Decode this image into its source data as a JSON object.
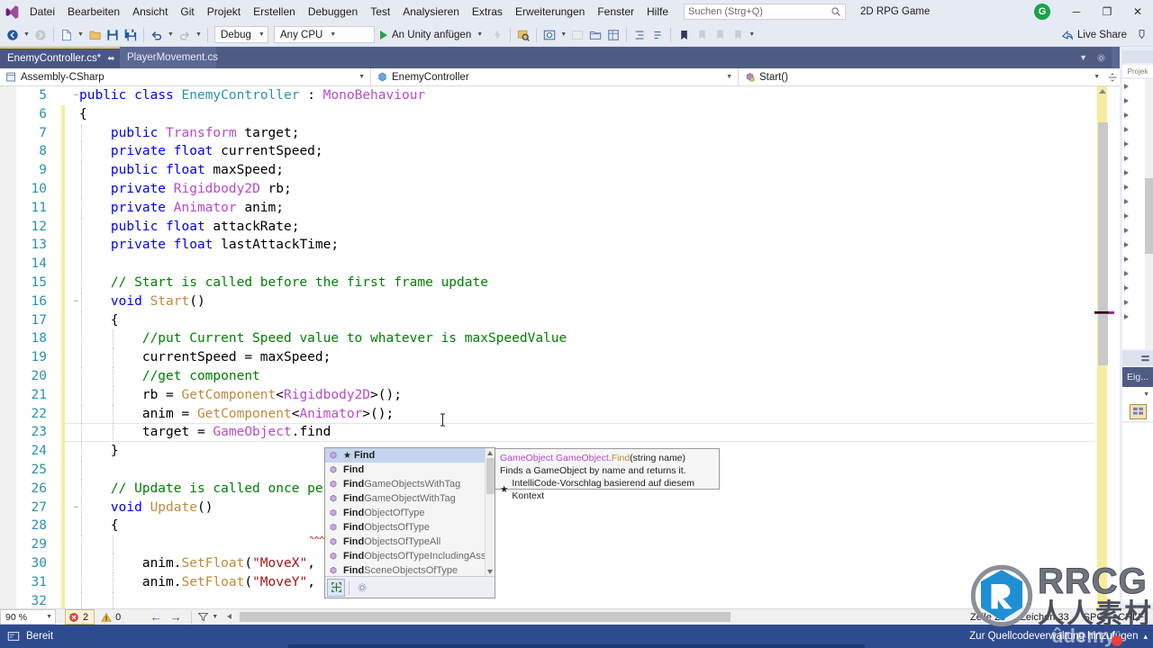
{
  "window": {
    "menus": [
      "Datei",
      "Bearbeiten",
      "Ansicht",
      "Git",
      "Projekt",
      "Erstellen",
      "Debuggen",
      "Test",
      "Analysieren",
      "Extras",
      "Erweiterungen",
      "Fenster",
      "Hilfe"
    ],
    "search_placeholder": "Suchen (Strg+Q)",
    "solution_name": "2D RPG Game",
    "account_initial": "G",
    "minimize_label": "─",
    "restore_label": "❐",
    "close_label": "✕"
  },
  "toolbar": {
    "config_value": "Debug",
    "platform_value": "Any CPU",
    "run_label": "An Unity anfügen",
    "live_share_label": "Live Share"
  },
  "tabs": [
    {
      "label": "EnemyController.cs*",
      "active": true,
      "pin": "⬌",
      "close": "✕"
    },
    {
      "label": "PlayerMovement.cs",
      "active": false
    }
  ],
  "tool_window_tab": "Proj...",
  "navbar": {
    "project": "Assembly-CSharp",
    "type": "EnemyController",
    "member": "Start()",
    "caret": "▾"
  },
  "editor": {
    "first_line_number": 5,
    "lines": [
      {
        "n": 5,
        "fold": "−",
        "indent": 0,
        "tokens": [
          [
            "kw",
            "public"
          ],
          [
            "pln",
            " "
          ],
          [
            "kw",
            "class"
          ],
          [
            "pln",
            " "
          ],
          [
            "typ",
            "EnemyController"
          ],
          [
            "pln",
            " : "
          ],
          [
            "utyp",
            "MonoBehaviour"
          ]
        ]
      },
      {
        "n": 6,
        "fold": "",
        "indent": 0,
        "tokens": [
          [
            "pln",
            "{"
          ]
        ]
      },
      {
        "n": 7,
        "fold": "",
        "indent": 1,
        "tokens": [
          [
            "pln",
            "    "
          ],
          [
            "kw",
            "public"
          ],
          [
            "pln",
            " "
          ],
          [
            "utyp",
            "Transform"
          ],
          [
            "pln",
            " target;"
          ]
        ]
      },
      {
        "n": 8,
        "fold": "",
        "indent": 1,
        "tokens": [
          [
            "pln",
            "    "
          ],
          [
            "kw",
            "private"
          ],
          [
            "pln",
            " "
          ],
          [
            "kw",
            "float"
          ],
          [
            "pln",
            " currentSpeed;"
          ]
        ]
      },
      {
        "n": 9,
        "fold": "",
        "indent": 1,
        "tokens": [
          [
            "pln",
            "    "
          ],
          [
            "kw",
            "public"
          ],
          [
            "pln",
            " "
          ],
          [
            "kw",
            "float"
          ],
          [
            "pln",
            " maxSpeed;"
          ]
        ]
      },
      {
        "n": 10,
        "fold": "",
        "indent": 1,
        "tokens": [
          [
            "pln",
            "    "
          ],
          [
            "kw",
            "private"
          ],
          [
            "pln",
            " "
          ],
          [
            "utyp",
            "Rigidbody2D"
          ],
          [
            "pln",
            " rb;"
          ]
        ]
      },
      {
        "n": 11,
        "fold": "",
        "indent": 1,
        "tokens": [
          [
            "pln",
            "    "
          ],
          [
            "kw",
            "private"
          ],
          [
            "pln",
            " "
          ],
          [
            "utyp",
            "Animator"
          ],
          [
            "pln",
            " anim;"
          ]
        ]
      },
      {
        "n": 12,
        "fold": "",
        "indent": 1,
        "tokens": [
          [
            "pln",
            "    "
          ],
          [
            "kw",
            "public"
          ],
          [
            "pln",
            " "
          ],
          [
            "kw",
            "float"
          ],
          [
            "pln",
            " attackRate;"
          ]
        ]
      },
      {
        "n": 13,
        "fold": "",
        "indent": 1,
        "tokens": [
          [
            "pln",
            "    "
          ],
          [
            "kw",
            "private"
          ],
          [
            "pln",
            " "
          ],
          [
            "kw",
            "float"
          ],
          [
            "pln",
            " lastAttackTime;"
          ]
        ]
      },
      {
        "n": 14,
        "fold": "",
        "indent": 1,
        "tokens": [
          [
            "pln",
            ""
          ]
        ]
      },
      {
        "n": 15,
        "fold": "",
        "indent": 1,
        "tokens": [
          [
            "pln",
            "    "
          ],
          [
            "cmt",
            "// Start is called before the first frame update"
          ]
        ]
      },
      {
        "n": 16,
        "fold": "−",
        "indent": 1,
        "tokens": [
          [
            "pln",
            "    "
          ],
          [
            "kw",
            "void"
          ],
          [
            "pln",
            " "
          ],
          [
            "meth",
            "Start"
          ],
          [
            "pln",
            "()"
          ]
        ]
      },
      {
        "n": 17,
        "fold": "",
        "indent": 1,
        "tokens": [
          [
            "pln",
            "    {"
          ]
        ]
      },
      {
        "n": 18,
        "fold": "",
        "indent": 2,
        "tokens": [
          [
            "pln",
            "        "
          ],
          [
            "cmt",
            "//put Current Speed value to whatever is maxSpeedValue"
          ]
        ]
      },
      {
        "n": 19,
        "fold": "",
        "indent": 2,
        "tokens": [
          [
            "pln",
            "        currentSpeed = maxSpeed;"
          ]
        ]
      },
      {
        "n": 20,
        "fold": "",
        "indent": 2,
        "tokens": [
          [
            "pln",
            "        "
          ],
          [
            "cmt",
            "//get component"
          ]
        ]
      },
      {
        "n": 21,
        "fold": "",
        "indent": 2,
        "tokens": [
          [
            "pln",
            "        rb = "
          ],
          [
            "meth",
            "GetComponent"
          ],
          [
            "pln",
            "<"
          ],
          [
            "utyp",
            "Rigidbody2D"
          ],
          [
            "pln",
            ">();"
          ]
        ]
      },
      {
        "n": 22,
        "fold": "",
        "indent": 2,
        "tokens": [
          [
            "pln",
            "        anim = "
          ],
          [
            "meth",
            "GetComponent"
          ],
          [
            "pln",
            "<"
          ],
          [
            "utyp",
            "Animator"
          ],
          [
            "pln",
            ">();"
          ]
        ]
      },
      {
        "n": 23,
        "fold": "",
        "indent": 2,
        "current": true,
        "tokens": [
          [
            "pln",
            "        target = "
          ],
          [
            "utyp",
            "GameObject"
          ],
          [
            "pln",
            ".find"
          ]
        ]
      },
      {
        "n": 24,
        "fold": "",
        "indent": 1,
        "tokens": [
          [
            "pln",
            "    }"
          ]
        ]
      },
      {
        "n": 25,
        "fold": "",
        "indent": 1,
        "tokens": [
          [
            "pln",
            ""
          ]
        ]
      },
      {
        "n": 26,
        "fold": "",
        "indent": 1,
        "tokens": [
          [
            "pln",
            "    "
          ],
          [
            "cmt",
            "// Update is called once per frame"
          ]
        ]
      },
      {
        "n": 27,
        "fold": "−",
        "indent": 1,
        "tokens": [
          [
            "pln",
            "    "
          ],
          [
            "kw",
            "void"
          ],
          [
            "pln",
            " "
          ],
          [
            "meth",
            "Update"
          ],
          [
            "pln",
            "()"
          ]
        ]
      },
      {
        "n": 28,
        "fold": "",
        "indent": 1,
        "tokens": [
          [
            "pln",
            "    {"
          ]
        ]
      },
      {
        "n": 29,
        "fold": "",
        "indent": 2,
        "tokens": [
          [
            "pln",
            ""
          ]
        ]
      },
      {
        "n": 30,
        "fold": "",
        "indent": 2,
        "tokens": [
          [
            "pln",
            "        anim."
          ],
          [
            "meth",
            "SetFloat"
          ],
          [
            "pln",
            "("
          ],
          [
            "str",
            "\"MoveX\""
          ],
          [
            "pln",
            ", rb.velocity.x);"
          ]
        ]
      },
      {
        "n": 31,
        "fold": "",
        "indent": 2,
        "tokens": [
          [
            "pln",
            "        anim."
          ],
          [
            "meth",
            "SetFloat"
          ],
          [
            "pln",
            "("
          ],
          [
            "str",
            "\"MoveY\""
          ],
          [
            "pln",
            ", rb.velocity.y);"
          ]
        ]
      },
      {
        "n": 32,
        "fold": "",
        "indent": 2,
        "tokens": [
          [
            "pln",
            ""
          ]
        ]
      }
    ]
  },
  "intellisense": {
    "items": [
      {
        "prefix": "Find",
        "suffix": "",
        "starred": true,
        "selected": true
      },
      {
        "prefix": "Find",
        "suffix": "",
        "starred": false,
        "selected": false
      },
      {
        "prefix": "Find",
        "suffix": "GameObjectsWithTag",
        "starred": false,
        "selected": false
      },
      {
        "prefix": "Find",
        "suffix": "GameObjectWithTag",
        "starred": false,
        "selected": false
      },
      {
        "prefix": "Find",
        "suffix": "ObjectOfType",
        "starred": false,
        "selected": false
      },
      {
        "prefix": "Find",
        "suffix": "ObjectsOfType",
        "starred": false,
        "selected": false
      },
      {
        "prefix": "Find",
        "suffix": "ObjectsOfTypeAll",
        "starred": false,
        "selected": false
      },
      {
        "prefix": "Find",
        "suffix": "ObjectsOfTypeIncludingAssets",
        "starred": false,
        "selected": false
      },
      {
        "prefix": "Find",
        "suffix": "SceneObjectsOfType",
        "starred": false,
        "selected": false
      }
    ],
    "star_glyph": "★"
  },
  "tooltip": {
    "signature_type": "GameObject",
    "signature_qualifier": "GameObject.",
    "signature_member": "Find",
    "signature_params": "(string name)",
    "description": "Finds a GameObject by name and returns it.",
    "intellicode_note": "IntelliCode-Vorschlag basierend auf diesem Kontext",
    "star_glyph": "★"
  },
  "right_dock": {
    "solution_explorer_tab": "Proj...",
    "solution_explorer_label": "Projek",
    "properties_tab": "Eig...",
    "tree_node_count": 17
  },
  "edit_status": {
    "zoom": "90 %",
    "error_count": "2",
    "warning_count": "0",
    "prev_arrow": "←",
    "next_arrow": "→",
    "line_label": "Zeile",
    "line_value": "23",
    "col_label": "Zeichen",
    "col_value": "33",
    "spaces": "SPC",
    "line_endings": "CRLF"
  },
  "status_bar": {
    "ready_text": "Bereit",
    "source_control_text": "Zur Quellcodeverwaltung hinzufügen",
    "caret": "▴"
  },
  "branding": {
    "rrcg": "RRCG",
    "cn": "人人素材",
    "udemy": "ûdemy"
  },
  "colors": {
    "accent_blue": "#2F4B8F",
    "tab_strip": "#4F5B83",
    "active_tab_top": "#F2C14E",
    "keyword": "#0000FF",
    "type": "#2B91AF",
    "user_type": "#B84ACB",
    "comment": "#008000",
    "string": "#A31515",
    "method": "#C08A3E",
    "error_badge": "#E05252",
    "run_green": "#2E9E4F",
    "change_bar": "#F7EC9E"
  }
}
